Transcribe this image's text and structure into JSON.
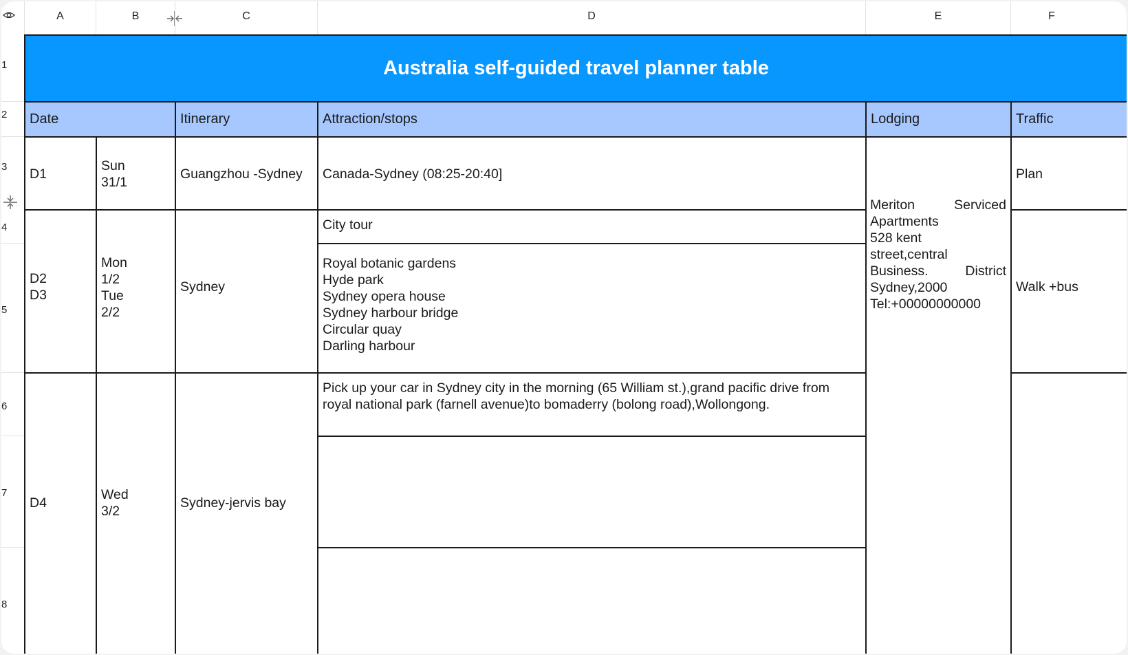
{
  "columns": [
    "A",
    "B",
    "C",
    "D",
    "E",
    "F"
  ],
  "rows": [
    "1",
    "2",
    "3",
    "4",
    "5",
    "6",
    "7",
    "8"
  ],
  "icons": {
    "corner": "eye-icon",
    "col_resize": "column-resize-icon",
    "row_resize": "row-resize-icon"
  },
  "colors": {
    "title_bg": "#0897ff",
    "header_bg": "#a6c8ff",
    "title_text": "#ffffff"
  },
  "title": "Australia self-guided travel planner table",
  "headers": {
    "date": "Date",
    "itinerary": "Itinerary",
    "attractions": "Attraction/stops",
    "lodging": "Lodging",
    "traffic": "Traffic"
  },
  "d1": {
    "day": "D1",
    "date_line1": "Sun",
    "date_line2": "31/1",
    "itinerary": "Guangzhou -Sydney",
    "attraction": "Canada-Sydney (08:25-20:40]",
    "traffic": "Plan"
  },
  "d2": {
    "day_line1": "D2",
    "day_line2": "D3",
    "date_line1": "Mon",
    "date_line2": "1/2",
    "date_line3": "Tue",
    "date_line4": "2/2",
    "itinerary": "Sydney",
    "attraction_row4": "City tour",
    "attractions_row5": [
      "Royal botanic gardens",
      "Hyde park",
      "Sydney opera house",
      "Sydney harbour bridge",
      "Circular quay",
      "Darling harbour"
    ],
    "traffic": "Walk +bus"
  },
  "lodging": {
    "line1a": "Meriton",
    "line1b": "Serviced",
    "line2": "Apartments",
    "line3": "528 kent",
    "line4": "street,central",
    "line5a": "Business.",
    "line5b": "District",
    "line6": "Sydney,2000",
    "line7": "Tel:+00000000000"
  },
  "d4": {
    "day": "D4",
    "date_line1": "Wed",
    "date_line2": "3/2",
    "itinerary": "Sydney-jervis bay",
    "attraction_line1": "Pick up your car in Sydney city in the morning (65 William st.),grand pacific drive from",
    "attraction_line2": "royal national park (farnell avenue)to bomaderry (bolong road),Wollongong."
  }
}
